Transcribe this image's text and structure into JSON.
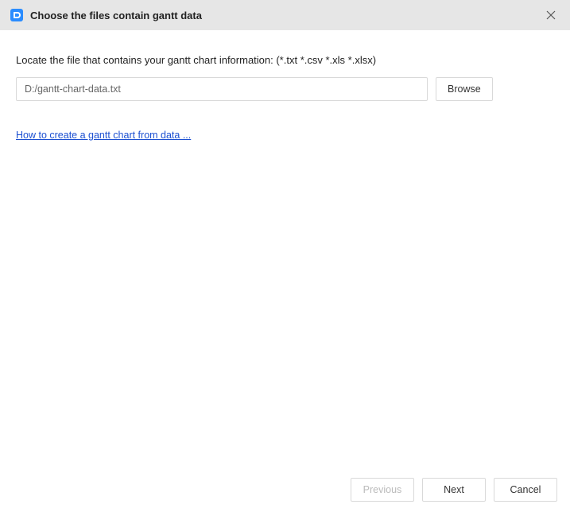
{
  "titlebar": {
    "title": "Choose the files contain gantt data"
  },
  "content": {
    "instruction": "Locate the file that contains your gantt chart information: (*.txt *.csv *.xls *.xlsx)",
    "file_path_value": "D:/gantt-chart-data.txt",
    "browse_label": "Browse",
    "help_link_text": "How to create a gantt chart from data ..."
  },
  "footer": {
    "previous_label": "Previous",
    "next_label": "Next",
    "cancel_label": "Cancel"
  }
}
